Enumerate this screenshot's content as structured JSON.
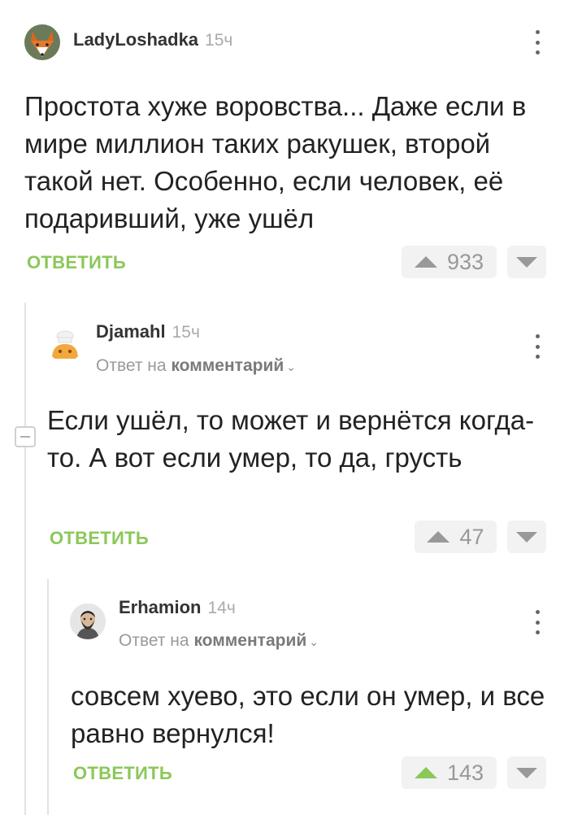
{
  "comments": [
    {
      "username": "LadyLoshadka",
      "time": "15ч",
      "text": "Простота хуже воровства... Даже если в мире миллион таких ракушек, второй такой нет. Особенно, если человек, её подаривший, уже ушёл",
      "reply_label": "ОТВЕТИТЬ",
      "rating": "933",
      "avatar_icon": "fox-avatar-icon"
    },
    {
      "username": "Djamahl",
      "time": "15ч",
      "reply_prefix": "Ответ на",
      "reply_link": "комментарий",
      "text": "Если ушёл, то может и вернётся когда-то. А вот если умер, то да, грусть",
      "reply_label": "ОТВЕТИТЬ",
      "rating": "47",
      "avatar_icon": "chef-avatar-icon"
    },
    {
      "username": "Erhamion",
      "time": "14ч",
      "reply_prefix": "Ответ на",
      "reply_link": "комментарий",
      "text": "совсем хуево, это если он умер, и все равно вернулся!",
      "reply_label": "ОТВЕТИТЬ",
      "rating": "143",
      "upvoted": true,
      "avatar_icon": "bearded-man-avatar-icon"
    }
  ],
  "colors": {
    "accent": "#8ac858",
    "muted": "#999999",
    "vote_bg": "#f2f2f2"
  }
}
